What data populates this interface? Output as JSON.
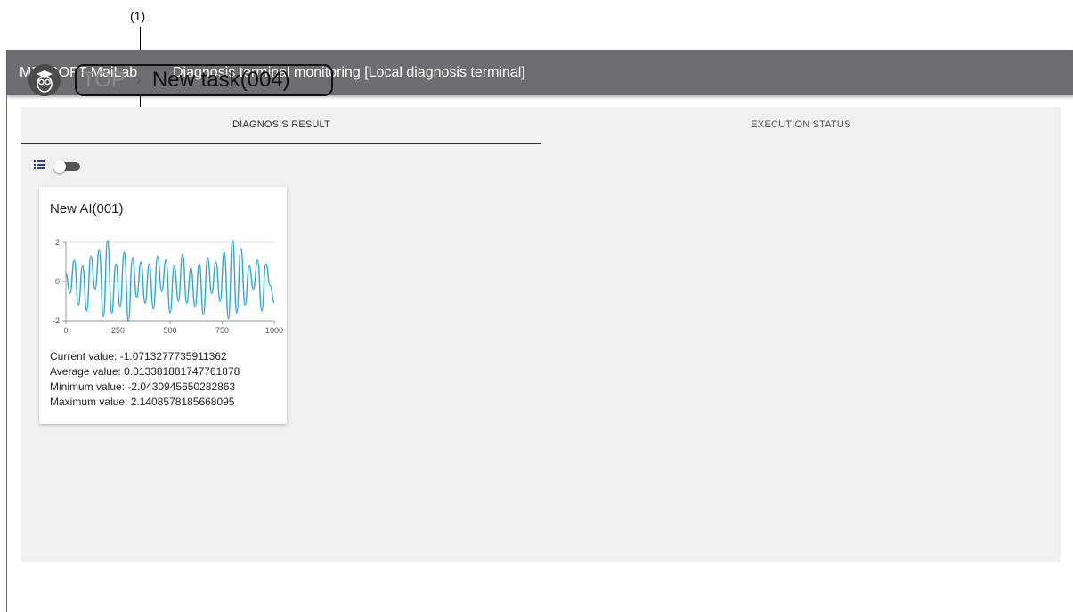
{
  "annotation": {
    "callout_label": "(1)"
  },
  "titlebar": {
    "app_name": "MELSOFT MaiLab",
    "window_title": "Diagnosis terminal monitoring [Local diagnosis terminal]"
  },
  "breadcrumb": {
    "root": "TOP",
    "separator": "›",
    "current": "New task(004)"
  },
  "tabs": [
    {
      "label": "DIAGNOSIS RESULT",
      "active": true
    },
    {
      "label": "EXECUTION STATUS",
      "active": false
    }
  ],
  "view_toggle": {
    "on": false
  },
  "card": {
    "title": "New AI(001)",
    "stats": {
      "current": "Current value: -1.0713277735911362",
      "average": "Average value: 0.013381881747761878",
      "minimum": "Minimum value: -2.0430945650282863",
      "maximum": "Maximum value: 2.1408578185668095"
    }
  },
  "chart_data": {
    "type": "line",
    "title": "",
    "xlabel": "",
    "ylabel": "",
    "xlim": [
      0,
      1000
    ],
    "ylim": [
      -2,
      2
    ],
    "x_ticks": [
      "0",
      "250",
      "500",
      "750",
      "1000"
    ],
    "y_ticks": [
      "2",
      "0",
      "-2"
    ],
    "line_color": "#29a8d8",
    "series": [
      {
        "x": [
          0,
          20,
          40,
          60,
          80,
          100,
          120,
          140,
          160,
          180,
          200,
          220,
          240,
          260,
          280,
          300,
          320,
          340,
          360,
          380,
          400,
          420,
          440,
          460,
          480,
          500,
          520,
          540,
          560,
          580,
          600,
          620,
          640,
          660,
          680,
          700,
          720,
          740,
          760,
          780,
          800,
          820,
          840,
          860,
          880,
          900,
          920,
          940,
          960,
          980,
          1000
        ],
        "y": [
          0.4,
          -0.6,
          1.1,
          -1.2,
          0.8,
          -1.5,
          1.3,
          -0.4,
          1.6,
          -1.8,
          2.1,
          -1.6,
          0.9,
          -1.3,
          1.5,
          -2.0,
          1.2,
          -0.8,
          1.0,
          -1.1,
          0.9,
          -1.4,
          1.3,
          -0.5,
          1.1,
          -1.6,
          0.8,
          -1.0,
          1.4,
          -1.1,
          0.7,
          -1.3,
          0.9,
          -1.7,
          1.2,
          -0.6,
          1.0,
          -1.0,
          1.5,
          -1.9,
          2.1,
          -1.6,
          1.7,
          -1.2,
          0.8,
          -0.4,
          1.1,
          -1.5,
          0.9,
          -0.2,
          -1.07
        ]
      }
    ]
  }
}
